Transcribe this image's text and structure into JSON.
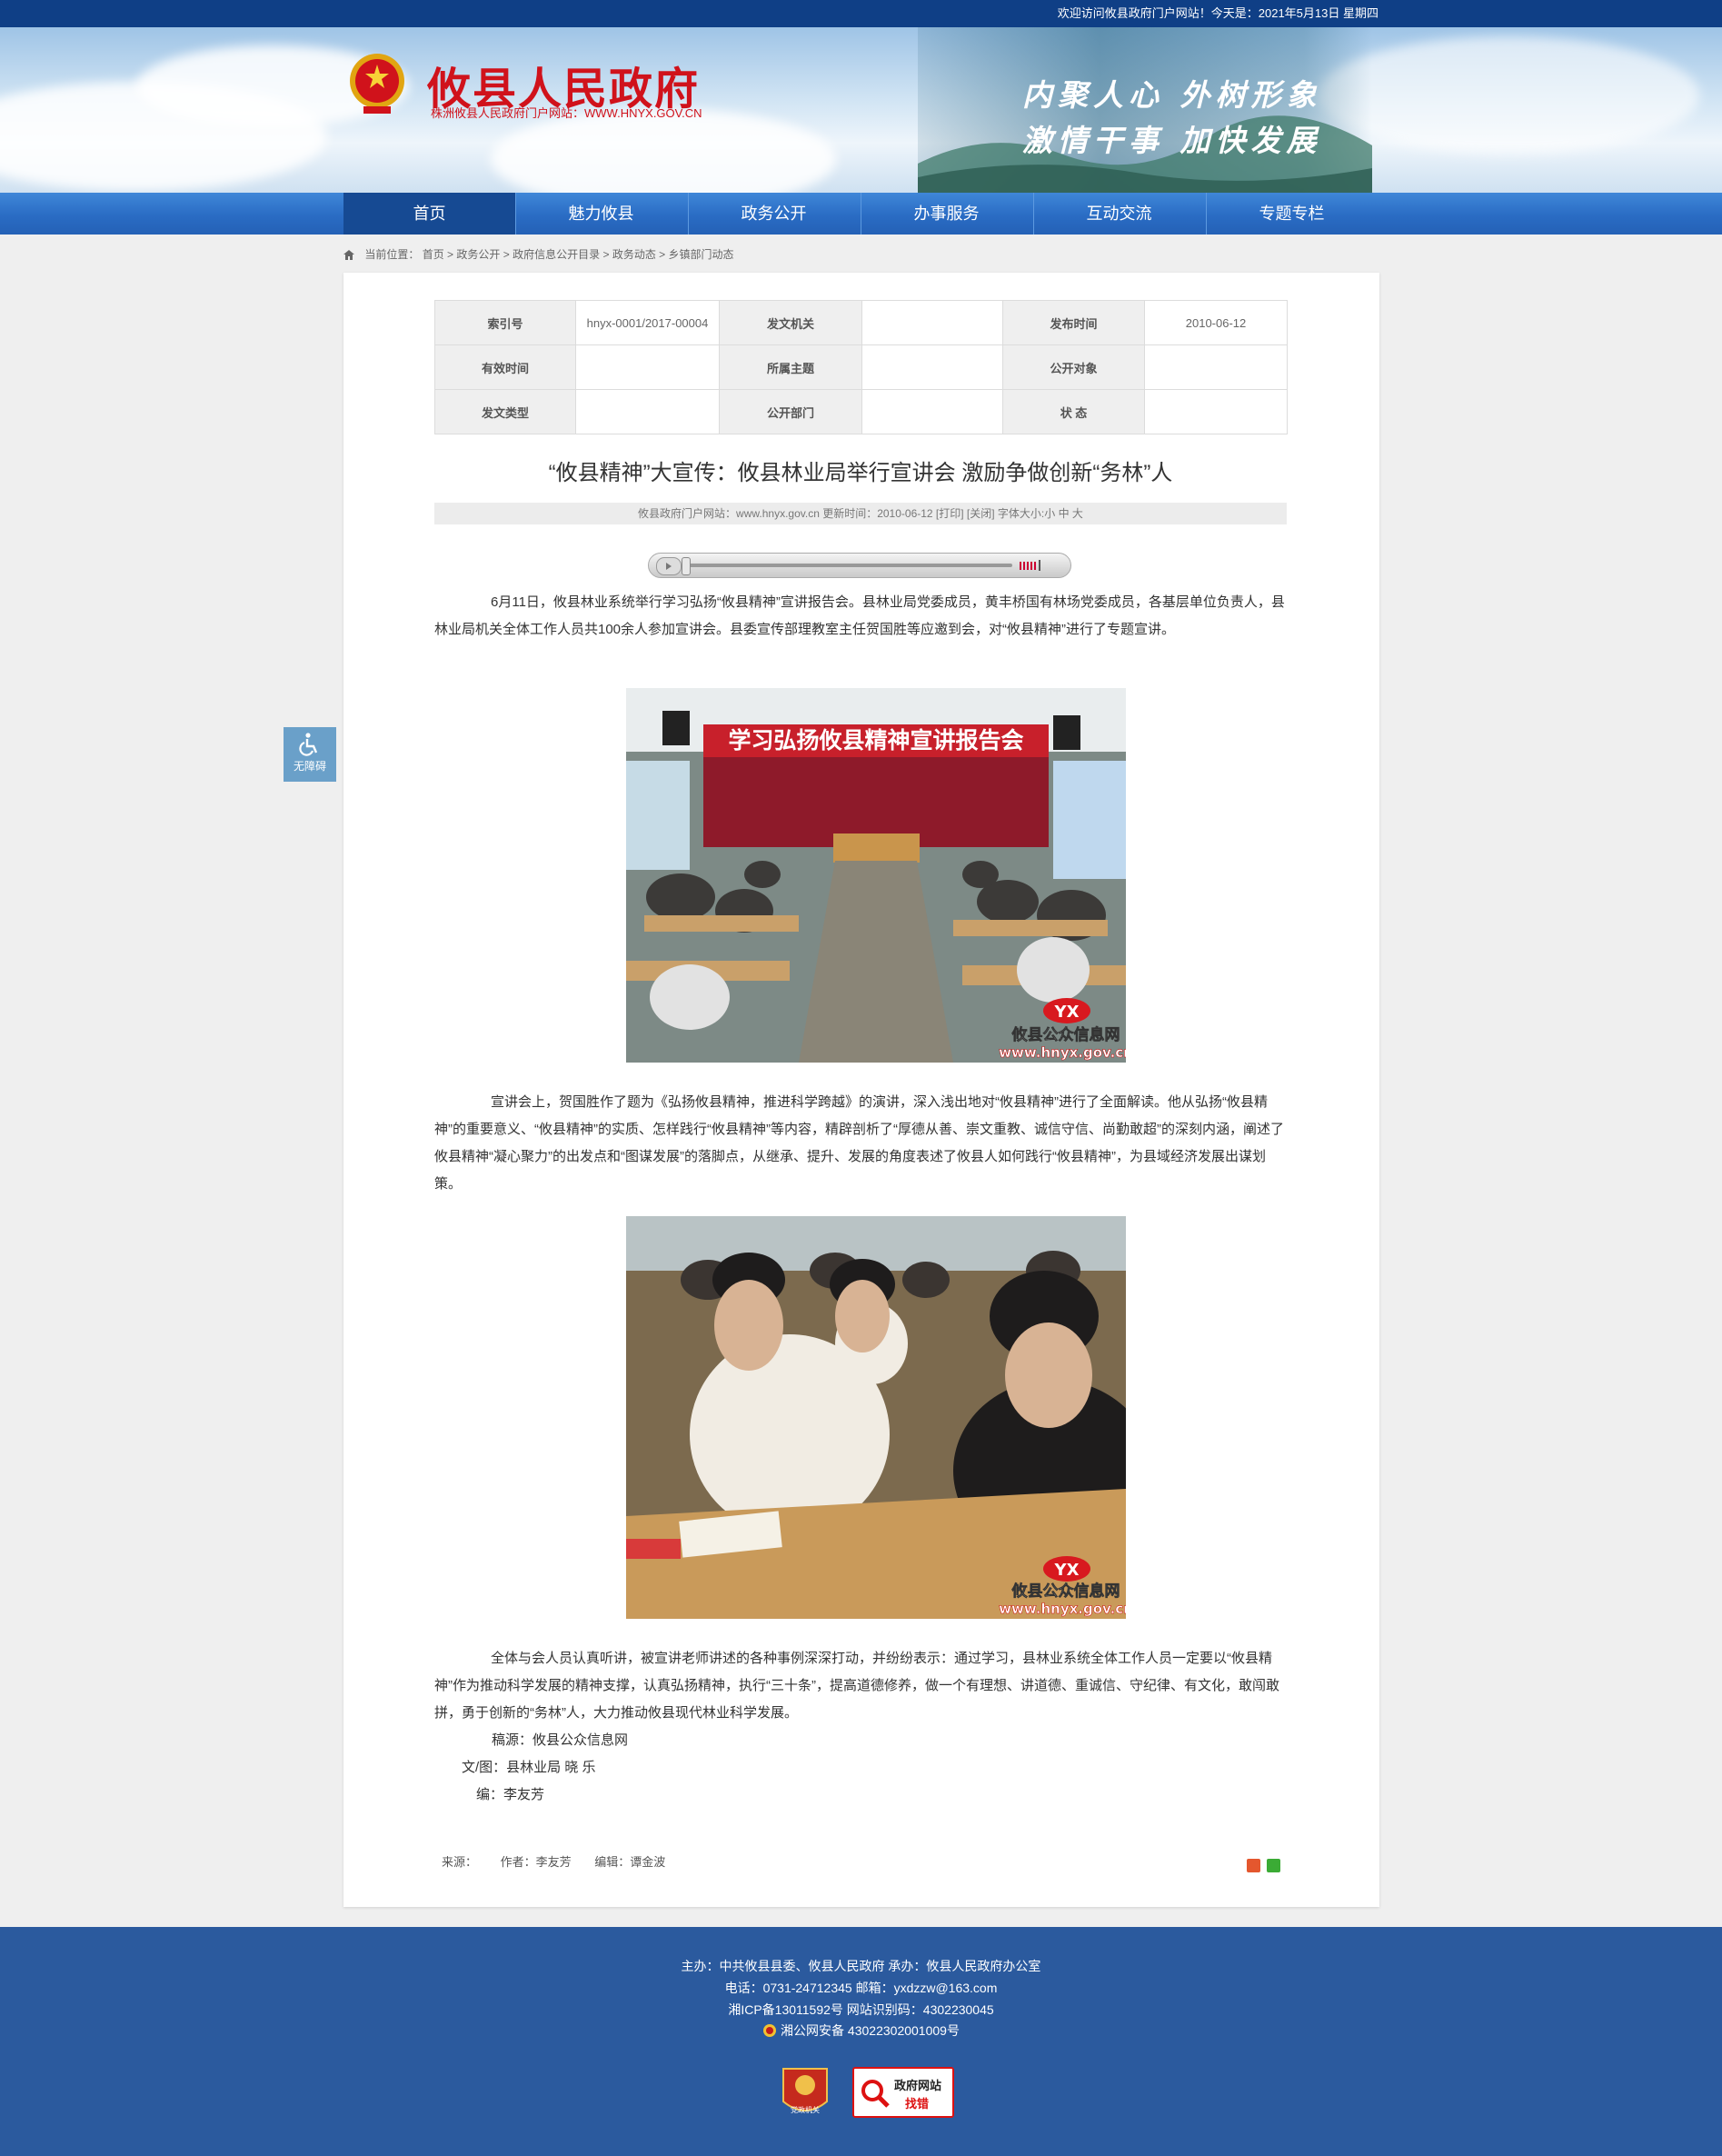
{
  "topbar": {
    "welcome": "欢迎访问攸县政府门户网站！今天是：2021年5月13日 星期四"
  },
  "header": {
    "site_title": "攸县人民政府",
    "site_subtitle": "株洲攸县人民政府门户网站：WWW.HNYX.GOV.CN",
    "slogan_line1": "内聚人心  外树形象",
    "slogan_line2": "激情干事  加快发展"
  },
  "nav": {
    "items": [
      {
        "label": "首页"
      },
      {
        "label": "魅力攸县"
      },
      {
        "label": "政务公开"
      },
      {
        "label": "办事服务"
      },
      {
        "label": "互动交流"
      },
      {
        "label": "专题专栏"
      }
    ]
  },
  "breadcrumb": {
    "prefix": "当前位置：",
    "items": [
      "首页",
      "政务公开",
      "政府信息公开目录",
      "政务动态",
      "乡镇部门动态"
    ],
    "separator": " > "
  },
  "info_table": {
    "rows": [
      [
        "索引号",
        "hnyx-0001/2017-00004",
        "发文机关",
        "",
        "发布时间",
        "2010-06-12"
      ],
      [
        "有效时间",
        "",
        "所属主题",
        "",
        "公开对象",
        ""
      ],
      [
        "发文类型",
        "",
        "公开部门",
        "",
        "状 态",
        ""
      ]
    ]
  },
  "article": {
    "title": "“攸县精神”大宣传：攸县林业局举行宣讲会 激励争做创新“务林”人",
    "meta": "攸县政府门户网站：www.hnyx.gov.cn   更新时间：2010-06-12  [打印] [关闭]  字体大小:小 中 大",
    "para1": "6月11日，攸县林业系统举行学习弘扬“攸县精神”宣讲报告会。县林业局党委成员，黄丰桥国有林场党委成员，各基层单位负责人，县林业局机关全体工作人员共100余人参加宣讲会。县委宣传部理教室主任贺国胜等应邀到会，对“攸县精神”进行了专题宣讲。",
    "photo1_banner": "学习弘扬攸县精神宣讲报告会",
    "photo_watermark_logo": "YX",
    "photo_watermark_name": "攸县公众信息网",
    "photo_watermark_url": "www.hnyx.gov.cn",
    "para2": "宣讲会上，贺国胜作了题为《弘扬攸县精神，推进科学跨越》的演讲，深入浅出地对“攸县精神”进行了全面解读。他从弘扬“攸县精神”的重要意义、“攸县精神”的实质、怎样践行“攸县精神”等内容，精辟剖析了“厚德从善、崇文重教、诚信守信、尚勤敢超”的深刻内涵，阐述了攸县精神“凝心聚力”的出发点和“图谋发展”的落脚点，从继承、提升、发展的角度表述了攸县人如何践行“攸县精神”，为县域经济发展出谋划策。",
    "para3": "全体与会人员认真听讲，被宣讲老师讲述的各种事例深深打动，并纷纷表示：通过学习，县林业系统全体工作人员一定要以“攸县精神”作为推动科学发展的精神支撑，认真弘扬精神，执行“三十条”，提高道德修养，做一个有理想、讲道德、重诚信、守纪律、有文化，敢闯敢拼，勇于创新的“务林”人，大力推动攸县现代林业科学发展。",
    "source_line": "稿源：攸县公众信息网",
    "text_photo_line": "文/图：县林业局 晓 乐",
    "editor_line": "编：李友芳"
  },
  "article_footer": {
    "source": "来源：",
    "author": "作者：李友芳",
    "editor": "编辑：谭金波"
  },
  "accessibility": {
    "label": "无障碍"
  },
  "footer": {
    "line1": "主办：中共攸县县委、攸县人民政府 承办：攸县人民政府办公室",
    "line2": "电话：0731-24712345 邮箱：yxdzzw@163.com",
    "line3": "湘ICP备13011592号    网站识别码：4302230045",
    "line4": "湘公网安备 43022302001009号",
    "badge1": "党政机关",
    "badge2_line1": "政府网站",
    "badge2_line2": "找错"
  },
  "colors": {
    "topbar": "#0f3f86",
    "nav": "#2a6cc4",
    "nav_active": "#164a93",
    "title_red": "#d0121b",
    "footer": "#2b5a9e"
  }
}
